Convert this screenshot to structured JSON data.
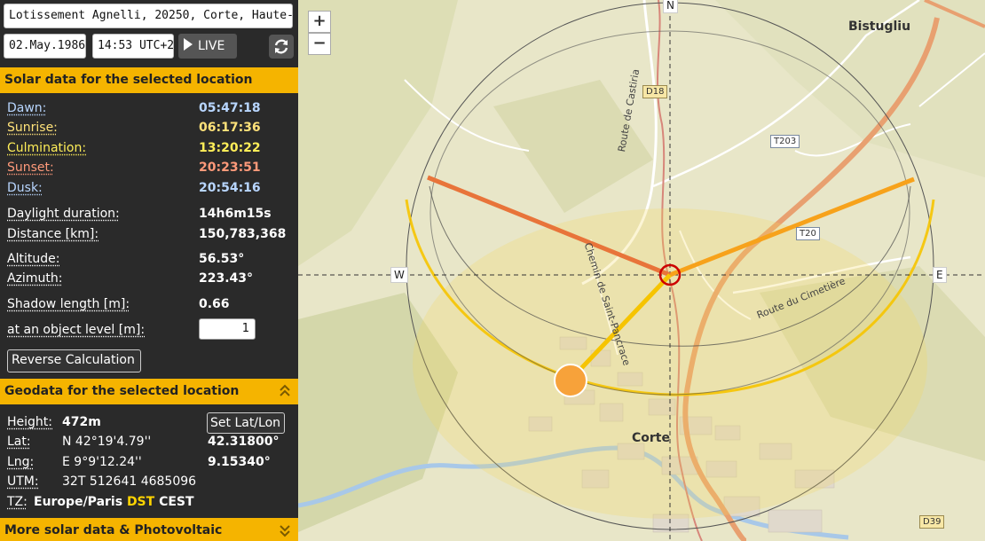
{
  "header": {
    "address": "Lotissement Agnelli, 20250, Corte, Haute-Corse,",
    "date": "02.May.1986",
    "time": "14:53 UTC+2",
    "live_label": "LIVE"
  },
  "solar": {
    "title": "Solar data for the selected location",
    "rows": [
      {
        "label": "Dawn:",
        "value": "05:47:18"
      },
      {
        "label": "Sunrise:",
        "value": "06:17:36"
      },
      {
        "label": "Culmination:",
        "value": "13:20:22"
      },
      {
        "label": "Sunset:",
        "value": "20:23:51"
      },
      {
        "label": "Dusk:",
        "value": "20:54:16"
      },
      {
        "label": "Daylight duration:",
        "value": "14h6m15s"
      },
      {
        "label": "Distance [km]:",
        "value": "150,783,368"
      },
      {
        "label": "Altitude:",
        "value": "56.53°"
      },
      {
        "label": "Azimuth:",
        "value": "223.43°"
      },
      {
        "label": "Shadow length [m]:",
        "value": "0.66"
      },
      {
        "label": "at an object level [m]:",
        "value": "1"
      }
    ],
    "reverse_button": "Reverse Calculation",
    "colors": {
      "dawn": "#b8d6ff",
      "sunrise": "#ffe27a",
      "culmination": "#ffee58",
      "sunset": "#ff9a7a",
      "dusk": "#b8d6ff"
    }
  },
  "geo": {
    "title": "Geodata for the selected location",
    "height_label": "Height:",
    "height_value": "472m",
    "set_button": "Set Lat/Lon",
    "lat_label": "Lat:",
    "lat_dms": "N 42°19'4.79''",
    "lat_dec": "42.31800°",
    "lng_label": "Lng:",
    "lng_dms": "E 9°9'12.24''",
    "lng_dec": "9.15340°",
    "utm_label": "UTM:",
    "utm_value": "32T 512641 4685096",
    "tz_label": "TZ:",
    "tz_zone": "Europe/Paris",
    "tz_dst": "DST",
    "tz_abbr": "CEST"
  },
  "more": {
    "title": "More solar data & Photovoltaic"
  },
  "map": {
    "zoom_in": "+",
    "zoom_out": "−",
    "compass": {
      "n": "N",
      "e": "E",
      "w": "W"
    },
    "places": {
      "bistugliu": "Bistugliu",
      "corte": "Corte"
    },
    "roads": {
      "d18": "D18",
      "t203": "T203",
      "t20": "T20",
      "d39": "D39",
      "castiria": "Route de Castiria",
      "cimetiere": "Route du Cimetière",
      "saint_pancrace": "Chemin de Saint-Pancrace"
    },
    "colors": {
      "sunrise_line": "#f7a21b",
      "sunset_line": "#e8743a",
      "sun_line": "#f6c400",
      "sun_disc": "#f7a23a"
    }
  }
}
